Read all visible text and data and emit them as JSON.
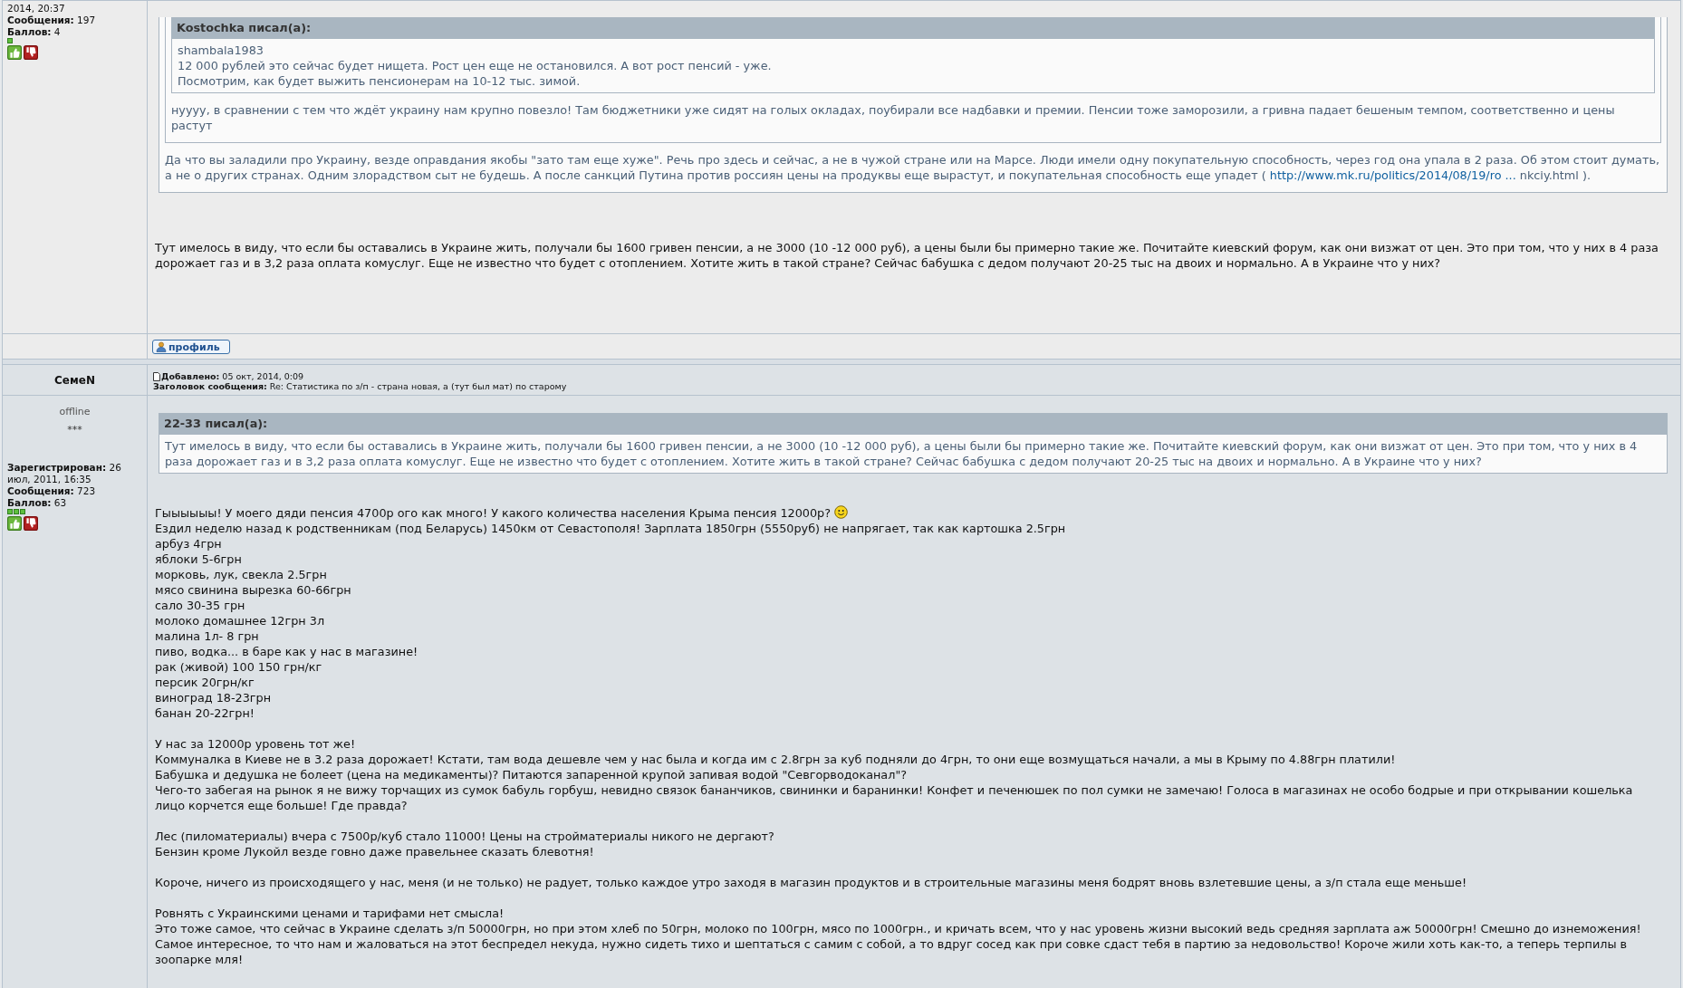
{
  "posts": [
    {
      "author": {
        "info": [
          "2014, 20:37",
          "**Сообщения:** 197",
          "**Баллов:** 4"
        ],
        "rank_squares": [
          {
            "filled": true
          }
        ]
      },
      "quote": {
        "quote": {
          "quote": {
            "header": "Kostochka писал(а):",
            "paragraphs": [
              [
                {
                  "kind": "text",
                  "text": "shambala1983"
                }
              ],
              [
                {
                  "kind": "text",
                  "text": "12 000 рублей это сейчас будет нищета. Рост цен еще не остановился. А вот рост пенсий - уже."
                }
              ],
              [
                {
                  "kind": "text",
                  "text": "Посмотрим, как будет выжить пенсионерам на 10-12 тыс. зимой."
                }
              ]
            ]
          },
          "paragraphs": [
            [
              {
                "kind": "text",
                "text": "нуууу, в сравнении с тем что ждёт украину нам крупно повезло! Там бюджетники уже сидят на голых окладах, поубирали все надбавки и премии. Пенсии тоже заморозили, а гривна падает бешеным темпом, соответственно и цены растут"
              }
            ]
          ]
        },
        "paragraphs": [
          [
            {
              "kind": "text",
              "text": "Да что вы заладили про Украину, везде оправдания якобы \"зато там еще хуже\". Речь про здесь и сейчас, а не в чужой стране или на Марсе. Люди имели одну покупательную способность, через год она упала в 2 раза. Об этом стоит думать, а не о других странах. Одним злорадством сыт не будешь. А после санкций Путина против россиян цены на продуквы еще вырастут, и покупательная способность еще упадет ( "
            },
            {
              "kind": "link",
              "text": "http://www.mk.ru/politics/2014/08/19/ro ..."
            },
            {
              "kind": "text",
              "text": " nkciy.html )."
            }
          ]
        ]
      },
      "blocks": [
        [
          {
            "text": "Тут имелось в виду, что если бы оставались в Украине жить, получали бы 1600 гривен пенсии, а не 3000 (10 -12 000 руб), а цены были бы примерно такие же. Почитайте киевский форум, как они визжат от цен. Это при том, что у них в 4 раза дорожает газ и в 3,2 раза оплата комуслуг. Еще не известно что будет с отоплением. Хотите жить в такой стране? Сейчас бабушка с дедом получают 20-25 тыс на двоих и нормально. А в Украине что у них?"
          }
        ]
      ],
      "profile_button": "профиль"
    },
    {
      "author": {
        "name": "СемеN",
        "status": "offline",
        "rank": "***",
        "info": [
          "**Зарегистрирован:** 26 июл, 2011, 16:35",
          "**Сообщения:** 723",
          "**Баллов:** 63"
        ],
        "rank_squares": [
          {
            "filled": true
          },
          {
            "filled": true
          },
          {
            "filled": true
          }
        ]
      },
      "header": [
        "**Добавлено:** 05 окт, 2014, 0:09",
        "**Заголовок сообщения:** Re: Статистика по з/п - страна новая, а (тут был мат) по старому"
      ],
      "quote": {
        "header": "22-33 писал(а):",
        "paragraphs": [
          [
            {
              "kind": "text",
              "text": "Тут имелось в виду, что если бы оставались в Украине жить, получали бы 1600 гривен пенсии, а не 3000 (10 -12 000 руб), а цены были бы примерно такие же. Почитайте киевский форум, как они визжат от цен. Это при том, что у них в 4 раза дорожает газ и в 3,2 раза оплата комуслуг. Еще не известно что будет с отоплением. Хотите жить в такой стране? Сейчас бабушка с дедом получают 20-25 тыс на двоих и нормально. А в Украине что у них?"
            }
          ]
        ]
      },
      "blocks": [
        [
          {
            "text": "Гыыыыыы! У моего дяди пенсия 4700р ого как много! У какого количества населения Крыма пенсия 12000р?",
            "smiley": true
          },
          {
            "text": "Ездил неделю назад к родственникам (под Беларусь) 1450км от Севастополя! Зарплата 1850грн (5550руб) не напрягает, так как картошка 2.5грн"
          },
          {
            "text": "арбуз 4грн"
          },
          {
            "text": "яблоки 5-6грн"
          },
          {
            "text": "морковь, лук, свекла 2.5грн"
          },
          {
            "text": "мясо свинина вырезка 60-66грн"
          },
          {
            "text": "сало 30-35 грн"
          },
          {
            "text": "молоко домашнее 12грн 3л"
          },
          {
            "text": "малина 1л- 8 грн"
          },
          {
            "text": "пиво, водка... в баре как у нас в магазине!"
          },
          {
            "text": "рак (живой) 100 150 грн/кг"
          },
          {
            "text": "персик 20грн/кг"
          },
          {
            "text": "виноград 18-23грн"
          },
          {
            "text": "банан 20-22грн!"
          }
        ],
        [
          {
            "text": "У нас за 12000р уровень тот же!"
          },
          {
            "text": "Коммуналка в Киеве не в 3.2 раза дорожает! Кстати, там вода дешевле чем у нас была и когда им с 2.8грн за куб подняли до 4грн, то они еще возмущаться начали, а мы в Крыму по 4.88грн платили!"
          },
          {
            "text": "Бабушка и дедушка не болеет (цена на медикаменты)? Питаются запаренной крупой запивая водой \"Севгорводоканал\"?"
          },
          {
            "text": "Чего-то забегая на рынок я не вижу торчащих из сумок бабуль горбуш, невидно связок бананчиков, свининки и баранинки! Конфет и печенюшек по пол сумки не замечаю! Голоса в магазинах не особо бодрые и при открывании кошелька лицо корчется еще больше! Где правда?"
          }
        ],
        [
          {
            "text": "Лес (пиломатериалы) вчера с 7500р/куб стало 11000! Цены на стройматериалы никого не дергают?"
          },
          {
            "text": "Бензин кроме Лукойл везде говно даже правельнее сказать блевотня!"
          }
        ],
        [
          {
            "text": "Короче, ничего из происходящего у нас, меня (и не только) не радует, только каждое утро заходя в магазин продуктов и в строительные магазины меня бодрят вновь взлетевшие цены, а з/п стала еще меньше!"
          }
        ],
        [
          {
            "text": "Ровнять с Украинскими ценами и тарифами нет смысла!"
          },
          {
            "text": "Это тоже самое, что сейчас в Украине сделать з/п 50000грн, но при этом хлеб по 50грн, молоко по 100грн, мясо по 1000грн., и кричать всем, что у нас уровень жизни высокий ведь средняя зарплата аж 50000грн! Смешно до изнеможения!"
          },
          {
            "text": "Самое интересное, то что нам и жаловаться на этот беспредел некуда, нужно сидеть тихо и шептаться с самим с собой, а то вдруг сосед как при совке сдаст тебя в партию за недовольство! Короче жили хоть как-то, а теперь терпилы в зоопарке мля!"
          }
        ]
      ]
    }
  ]
}
